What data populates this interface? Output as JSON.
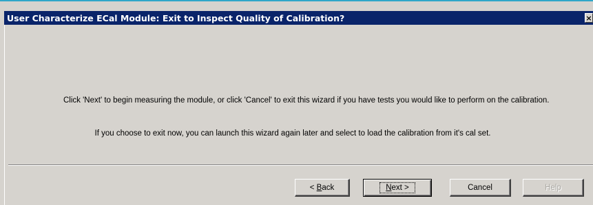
{
  "window": {
    "title": "User Characterize ECal Module: Exit to Inspect Quality of Calibration?",
    "close_glyph": "×"
  },
  "message": {
    "paragraph1": "Click 'Next' to begin measuring the module, or click 'Cancel' to exit this wizard if you have tests you would like to perform on the calibration.",
    "paragraph2": "If you choose to exit now, you can launch this wizard again later and select to load the calibration from it's cal set."
  },
  "buttons": {
    "back": {
      "prefix": "< ",
      "mnemonic": "B",
      "rest": "ack"
    },
    "next": {
      "mnemonic": "N",
      "rest": "ext >"
    },
    "cancel": "Cancel",
    "help": "Help"
  },
  "colors": {
    "titlebar": "#0a246a",
    "face": "#d6d3ce",
    "top_accent": "#2fa6c8"
  }
}
